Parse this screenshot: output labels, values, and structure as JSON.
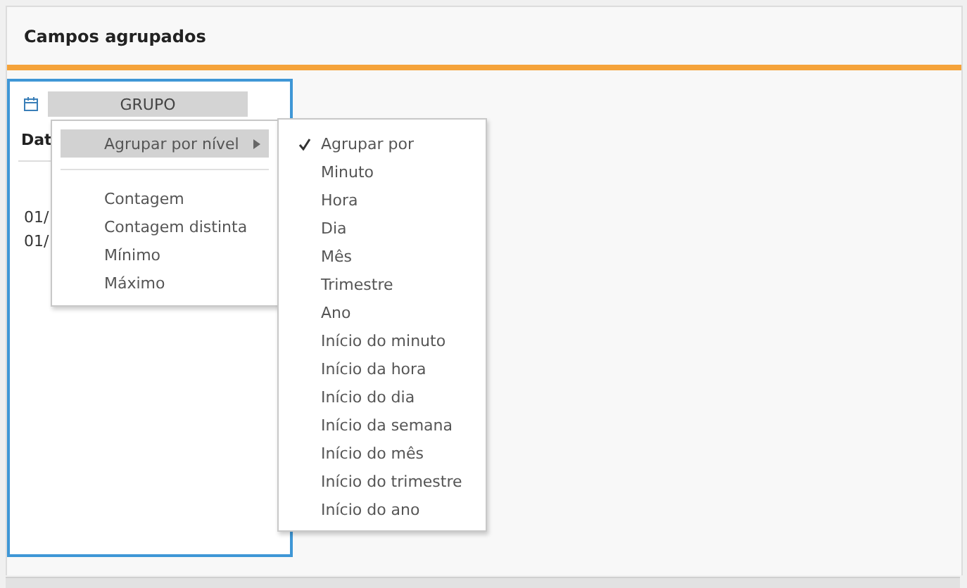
{
  "panel": {
    "title": "Campos agrupados"
  },
  "card": {
    "header": "GRUPO",
    "field_label": "Dat",
    "values": [
      "01/",
      "01/"
    ]
  },
  "context_menu": {
    "items": [
      {
        "kind": "submenu",
        "label": "Agrupar por nível",
        "selected": true
      },
      {
        "kind": "separator"
      },
      {
        "kind": "item",
        "label": "Contagem",
        "selected": false
      },
      {
        "kind": "item",
        "label": "Contagem distinta",
        "selected": false
      },
      {
        "kind": "item",
        "label": "Mínimo",
        "selected": false
      },
      {
        "kind": "item",
        "label": "Máximo",
        "selected": false
      }
    ]
  },
  "submenu": {
    "items": [
      {
        "label": "Agrupar por",
        "checked": true
      },
      {
        "label": "Minuto",
        "checked": false
      },
      {
        "label": "Hora",
        "checked": false
      },
      {
        "label": "Dia",
        "checked": false
      },
      {
        "label": "Mês",
        "checked": false
      },
      {
        "label": "Trimestre",
        "checked": false
      },
      {
        "label": "Ano",
        "checked": false
      },
      {
        "label": "Início do minuto",
        "checked": false
      },
      {
        "label": "Início da hora",
        "checked": false
      },
      {
        "label": "Início do dia",
        "checked": false
      },
      {
        "label": "Início da semana",
        "checked": false
      },
      {
        "label": "Início do mês",
        "checked": false
      },
      {
        "label": "Início do trimestre",
        "checked": false
      },
      {
        "label": "Início do ano",
        "checked": false
      }
    ]
  }
}
